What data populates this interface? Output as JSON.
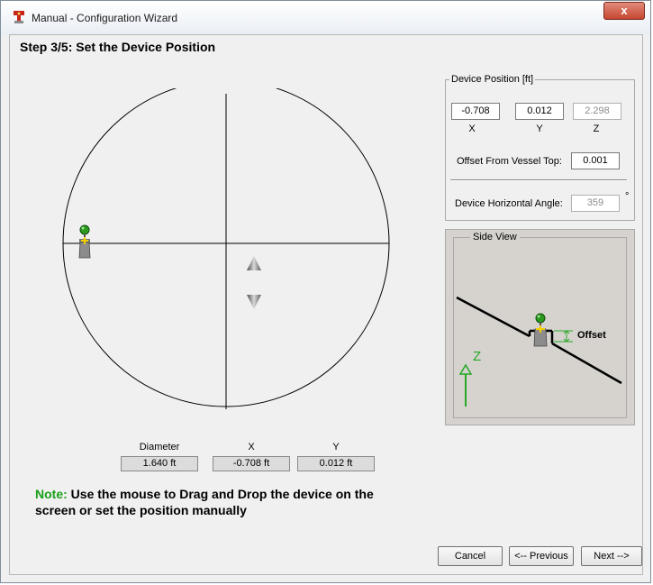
{
  "window": {
    "title": "Manual - Configuration Wizard",
    "close_label": "x"
  },
  "step": {
    "title": "Step 3/5: Set the Device Position"
  },
  "position_display": {
    "diameter_label": "Diameter",
    "diameter_value": "1.640 ft",
    "x_label": "X",
    "x_value": "-0.708 ft",
    "y_label": "Y",
    "y_value": "0.012 ft"
  },
  "note": {
    "label": "Note:",
    "text": " Use the mouse to Drag and Drop the device on the screen or set the position manually"
  },
  "device_position": {
    "legend": "Device Position [ft]",
    "x_value": "-0.708",
    "y_value": "0.012",
    "z_value": "2.298",
    "x_label": "X",
    "y_label": "Y",
    "z_label": "Z",
    "offset_label": "Offset From Vessel Top:",
    "offset_value": "0.001",
    "angle_label": "Device Horizontal Angle:",
    "angle_value": "359",
    "angle_unit": "°"
  },
  "side_view": {
    "legend": "Side View",
    "offset_label": "Offset",
    "z_label": "Z"
  },
  "buttons": {
    "cancel": "Cancel",
    "previous": "<-- Previous",
    "next": "Next -->"
  },
  "colors": {
    "note_accent": "#1aa01a",
    "axis_arrow": "#27a827",
    "device_green": "#2a9a1e"
  }
}
